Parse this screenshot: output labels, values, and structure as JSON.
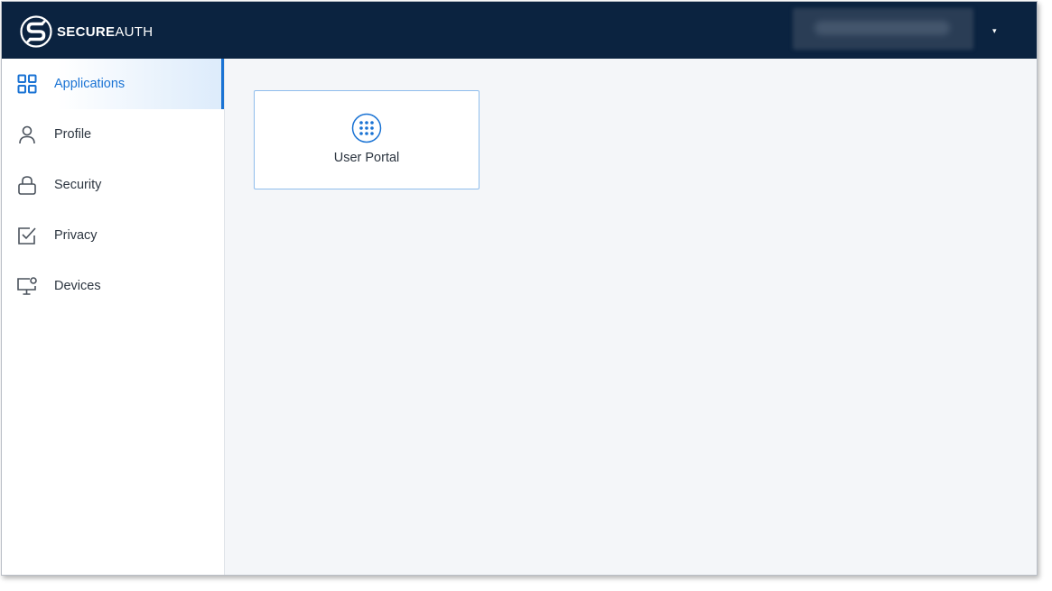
{
  "header": {
    "brand_bold": "SECURE",
    "brand_light": "AUTH",
    "user_menu_caret": "▾"
  },
  "sidebar": {
    "items": [
      {
        "label": "Applications",
        "icon": "grid-icon",
        "active": true
      },
      {
        "label": "Profile",
        "icon": "user-icon",
        "active": false
      },
      {
        "label": "Security",
        "icon": "lock-icon",
        "active": false
      },
      {
        "label": "Privacy",
        "icon": "checkbox-icon",
        "active": false
      },
      {
        "label": "Devices",
        "icon": "monitor-icon",
        "active": false
      }
    ]
  },
  "main": {
    "apps": [
      {
        "label": "User Portal",
        "icon": "dots-grid-icon"
      }
    ]
  },
  "colors": {
    "header_bg": "#0b2340",
    "accent": "#1a73d4",
    "content_bg": "#f4f6f9",
    "text": "#2c3540"
  }
}
